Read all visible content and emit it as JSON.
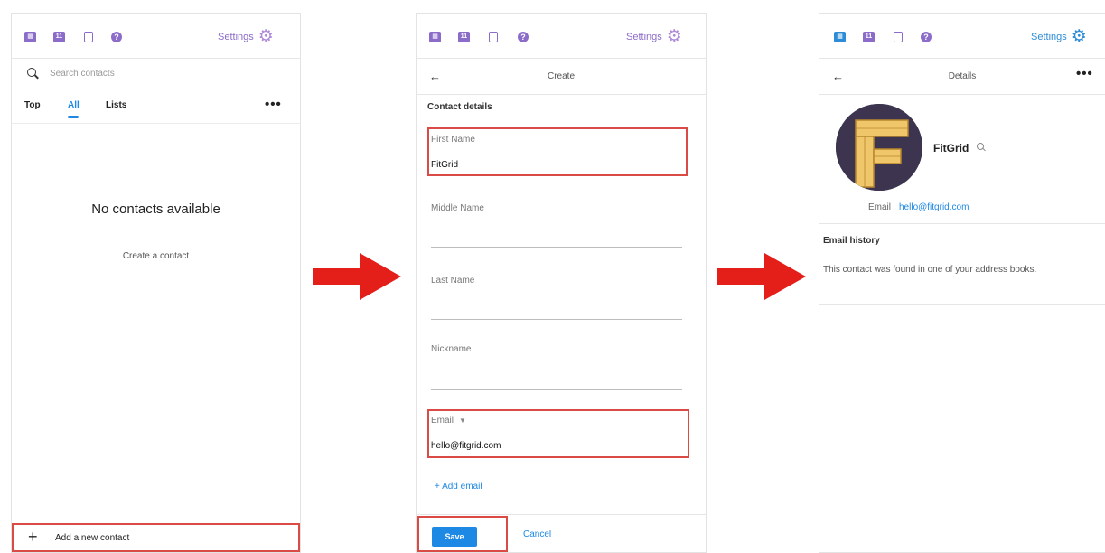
{
  "colors": {
    "accent": "#8c6cc9",
    "link_blue": "#1e88e5",
    "highlight_red": "#d94b44",
    "arrow_red": "#e41f1a"
  },
  "topbar": {
    "icons": [
      "contacts-icon",
      "calendar-icon",
      "notes-icon",
      "help-icon"
    ],
    "calendar_day": "11",
    "settings_label": "Settings"
  },
  "list_screen": {
    "search_placeholder": "Search contacts",
    "tabs": [
      "Top",
      "All",
      "Lists"
    ],
    "active_tab": "All",
    "more_label": "•••",
    "empty_title": "No contacts available",
    "create_link": "Create a contact",
    "add_new_contact": "Add a new contact"
  },
  "create_screen": {
    "back_label": "←",
    "title": "Create",
    "section": "Contact details",
    "fields": {
      "first_name_label": "First Name",
      "first_name_value": "FitGrid",
      "middle_name_label": "Middle Name",
      "last_name_label": "Last Name",
      "nickname_label": "Nickname",
      "email_label": "Email",
      "email_value": "hello@fitgrid.com"
    },
    "add_email": "+ Add email",
    "save": "Save",
    "cancel": "Cancel"
  },
  "details_screen": {
    "back_label": "←",
    "title": "Details",
    "more_label": "•••",
    "avatar_letter": "F",
    "name": "FitGrid",
    "email_label": "Email",
    "email_value": "hello@fitgrid.com",
    "history_title": "Email history",
    "history_text": "This contact was found in one of your address books."
  }
}
